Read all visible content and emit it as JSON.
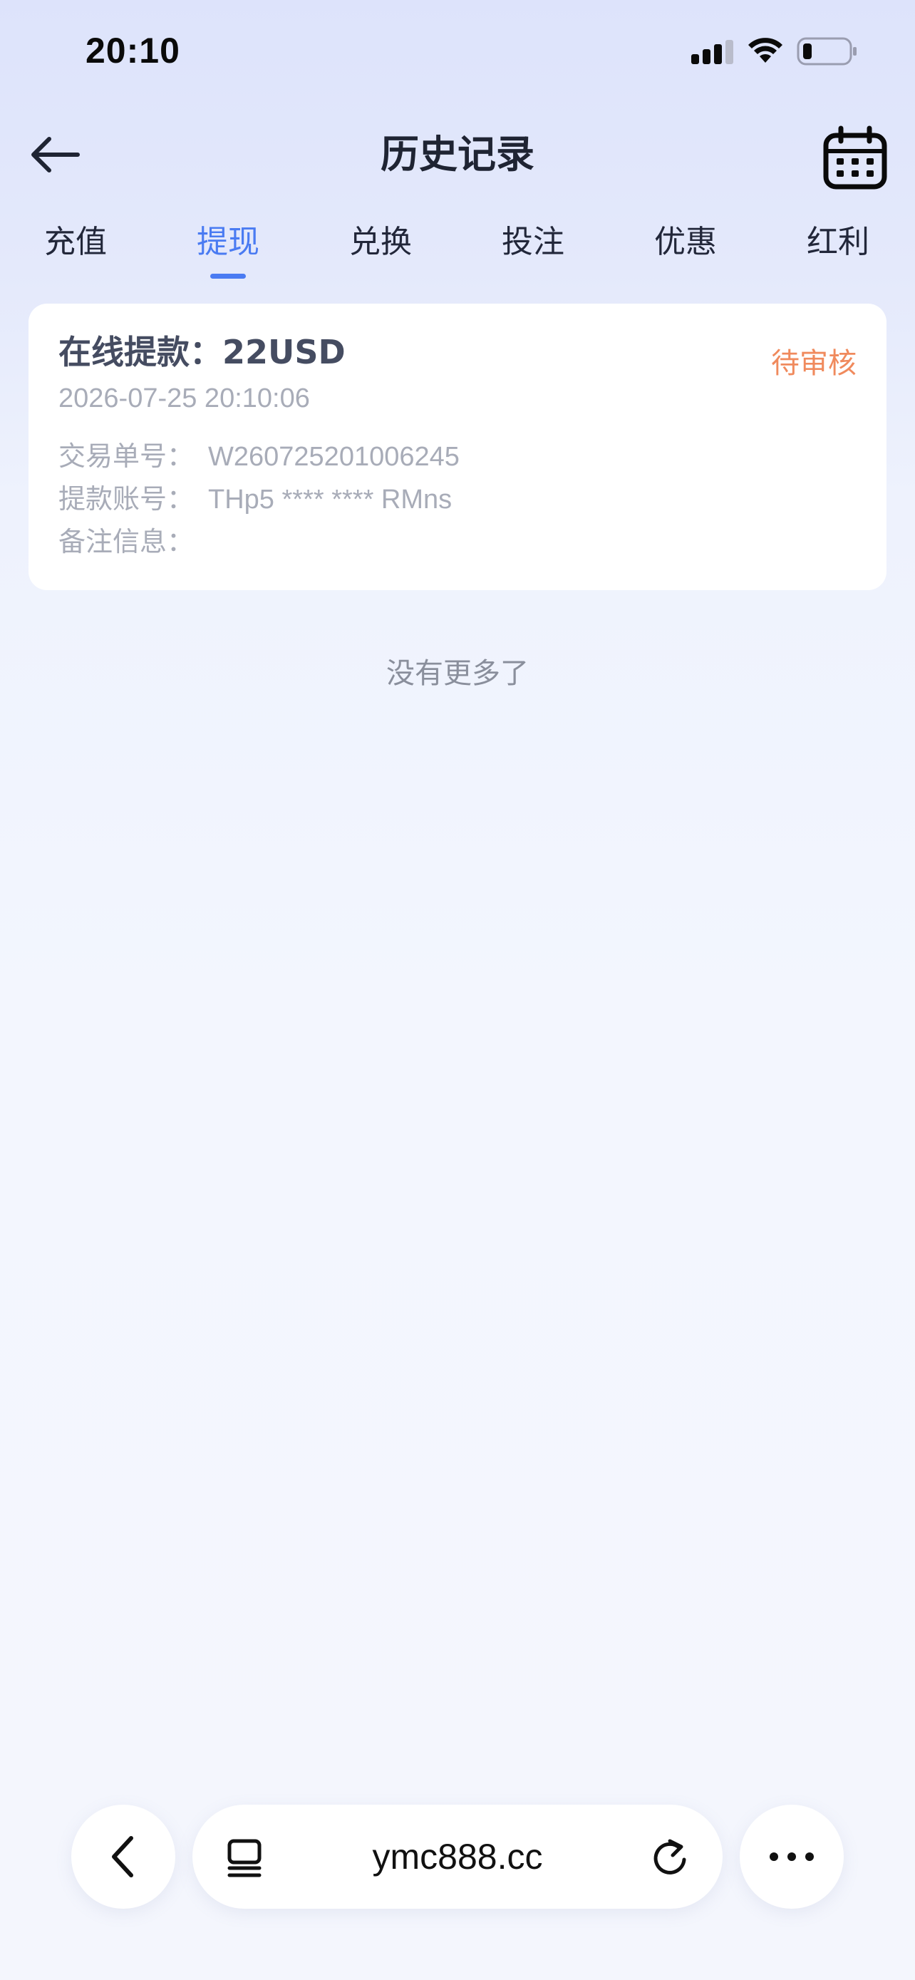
{
  "status_bar": {
    "time": "20:10"
  },
  "header": {
    "title": "历史记录"
  },
  "tabs": [
    {
      "label": "充值"
    },
    {
      "label": "提现",
      "active": true
    },
    {
      "label": "兑换"
    },
    {
      "label": "投注"
    },
    {
      "label": "优惠"
    },
    {
      "label": "红利"
    }
  ],
  "record": {
    "title": "在线提款：22USD",
    "status": "待审核",
    "datetime": "2026-07-25 20:10:06",
    "fields": [
      {
        "label": "交易单号：",
        "value": "W260725201006245"
      },
      {
        "label": "提款账号：",
        "value": "THp5 **** **** RMns"
      },
      {
        "label": "备注信息：",
        "value": ""
      }
    ]
  },
  "list_footer": "没有更多了",
  "browser": {
    "url": "ymc888.cc"
  },
  "colors": {
    "accent": "#4a7bf2",
    "status_pending": "#f08a5d"
  },
  "icons": [
    "back-arrow-icon",
    "calendar-icon",
    "chevron-left-icon",
    "tabs-icon",
    "reload-icon",
    "more-dots-icon"
  ]
}
